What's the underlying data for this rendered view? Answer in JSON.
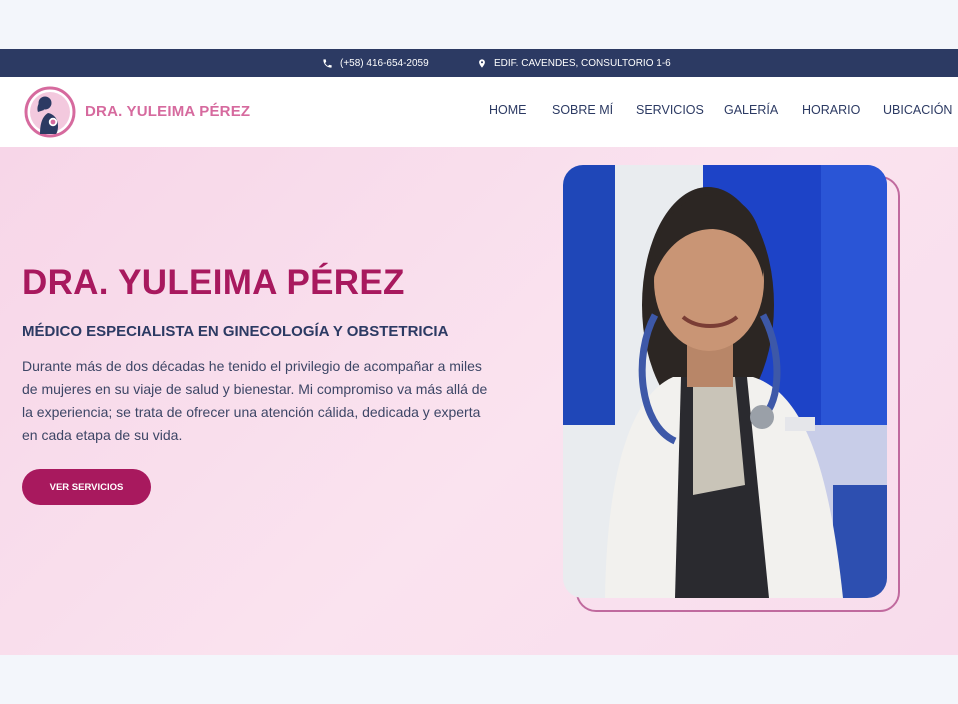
{
  "topbar": {
    "phone": "(+58) 416-654-2059",
    "address": "EDIF. CAVENDES, CONSULTORIO 1-6",
    "phone_icon": "phone-icon",
    "location_icon": "map-pin-icon"
  },
  "header": {
    "brand": "DRA. YULEIMA PÉREZ",
    "nav": {
      "home": "HOME",
      "sobre": "SOBRE MÍ",
      "servicios": "SERVICIOS",
      "galeria": "GALERÍA",
      "horario": "HORARIO",
      "ubicacion": "UBICACIÓN"
    }
  },
  "hero": {
    "title": "DRA. YULEIMA PÉREZ",
    "subtitle": "MÉDICO ESPECIALISTA EN GINECOLOGÍA Y OBSTETRICIA",
    "description": "Durante más de dos décadas he tenido el privilegio de acompañar a miles de mujeres en su viaje de salud y bienestar. Mi compromiso va más allá de la experiencia; se trata de ofrecer una atención cálida, dedicada y experta en cada etapa de su vida.",
    "cta": "VER SERVICIOS"
  },
  "colors": {
    "navy": "#2c3a63",
    "brand_pink": "#d66a9e",
    "accent_magenta": "#a8195e",
    "hero_bg": "#f8dcec"
  }
}
